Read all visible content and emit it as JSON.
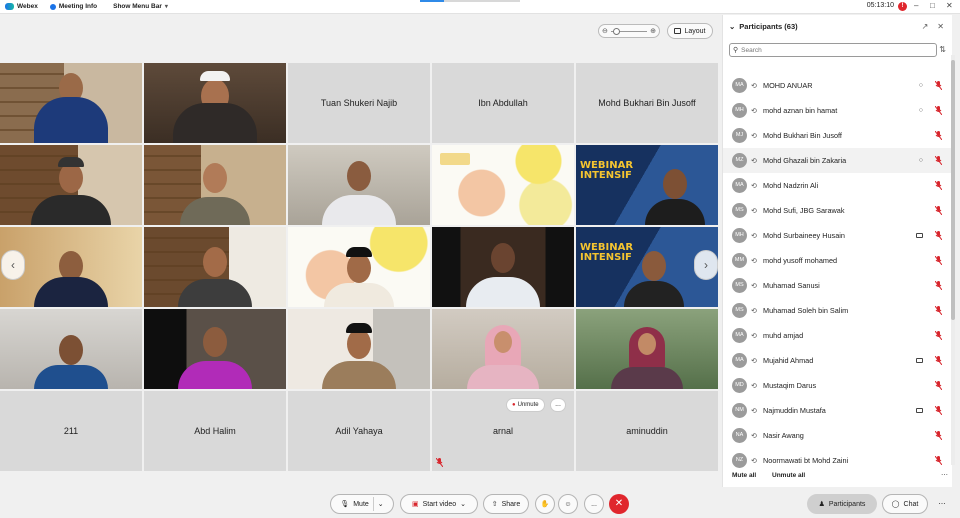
{
  "topbar": {
    "app_name": "Webex",
    "meeting_info": "Meeting Info",
    "show_menu_bar": "Show Menu Bar",
    "time": "05:13:10",
    "rec_badge": "!"
  },
  "view": {
    "layout_label": "Layout"
  },
  "grid": {
    "tiles": [
      {
        "name": "",
        "kind": "video"
      },
      {
        "name": "",
        "kind": "video"
      },
      {
        "name": "Tuan Shukeri Najib",
        "kind": "name"
      },
      {
        "name": "Ibn Abdullah",
        "kind": "name"
      },
      {
        "name": "Mohd Bukhari Bin Jusoff",
        "kind": "name"
      },
      {
        "name": "",
        "kind": "video"
      },
      {
        "name": "",
        "kind": "video"
      },
      {
        "name": "",
        "kind": "video"
      },
      {
        "name": "",
        "kind": "video"
      },
      {
        "name": "",
        "kind": "video"
      },
      {
        "name": "",
        "kind": "video"
      },
      {
        "name": "",
        "kind": "video"
      },
      {
        "name": "",
        "kind": "video"
      },
      {
        "name": "",
        "kind": "video"
      },
      {
        "name": "",
        "kind": "video"
      },
      {
        "name": "",
        "kind": "video"
      },
      {
        "name": "",
        "kind": "video"
      },
      {
        "name": "",
        "kind": "video"
      },
      {
        "name": "",
        "kind": "video"
      },
      {
        "name": "",
        "kind": "video"
      },
      {
        "name": "211",
        "kind": "name"
      },
      {
        "name": "Abd Halim",
        "kind": "name"
      },
      {
        "name": "Adil Yahaya",
        "kind": "name"
      },
      {
        "name": "arnal",
        "kind": "name"
      },
      {
        "name": "aminuddin",
        "kind": "name"
      }
    ],
    "webinar_text_1": "WEBINAR",
    "webinar_text_2": "INTENSIF",
    "unmute_label": "Unmute",
    "more_label": "..."
  },
  "participants": {
    "title": "Participants (63)",
    "search_placeholder": "Search",
    "rows": [
      {
        "initials": "MA",
        "name": "MOHD ANUAR",
        "chat": true,
        "cam": false,
        "highlight": false
      },
      {
        "initials": "MH",
        "name": "mohd aznan bin hamat",
        "chat": true,
        "cam": false,
        "highlight": false
      },
      {
        "initials": "MJ",
        "name": "Mohd Bukhari Bin Jusoff",
        "chat": false,
        "cam": false,
        "highlight": false
      },
      {
        "initials": "MZ",
        "name": "Mohd Ghazali bin Zakaria",
        "chat": true,
        "cam": false,
        "highlight": true
      },
      {
        "initials": "MA",
        "name": "Mohd Nadzrin Ali",
        "chat": false,
        "cam": false,
        "highlight": false
      },
      {
        "initials": "MS",
        "name": "Mohd Sufi, JBG Sarawak",
        "chat": false,
        "cam": false,
        "highlight": false
      },
      {
        "initials": "MH",
        "name": "Mohd Surbaineey Husain",
        "chat": false,
        "cam": true,
        "highlight": false
      },
      {
        "initials": "MM",
        "name": "mohd yusoff mohamed",
        "chat": false,
        "cam": false,
        "highlight": false
      },
      {
        "initials": "MS",
        "name": "Muhamad Sanusi",
        "chat": false,
        "cam": false,
        "highlight": false
      },
      {
        "initials": "MS",
        "name": "Muhamad Soleh bin Salim",
        "chat": false,
        "cam": false,
        "highlight": false
      },
      {
        "initials": "MA",
        "name": "muhd amjad",
        "chat": false,
        "cam": false,
        "highlight": false
      },
      {
        "initials": "MA",
        "name": "Mujahid Ahmad",
        "chat": false,
        "cam": true,
        "highlight": false
      },
      {
        "initials": "MD",
        "name": "Mustaqim Darus",
        "chat": false,
        "cam": false,
        "highlight": false
      },
      {
        "initials": "NM",
        "name": "Najmuddin Mustafa",
        "chat": false,
        "cam": true,
        "highlight": false
      },
      {
        "initials": "NA",
        "name": "Nasir Awang",
        "chat": false,
        "cam": false,
        "highlight": false
      },
      {
        "initials": "NZ",
        "name": "Noormawati bt Mohd Zaini",
        "chat": false,
        "cam": false,
        "highlight": false
      }
    ],
    "mute_all": "Mute all",
    "unmute_all": "Unmute all"
  },
  "toolbar": {
    "mute": "Mute",
    "start_video": "Start video",
    "share": "Share",
    "more": "...",
    "participants": "Participants",
    "chat": "Chat"
  }
}
